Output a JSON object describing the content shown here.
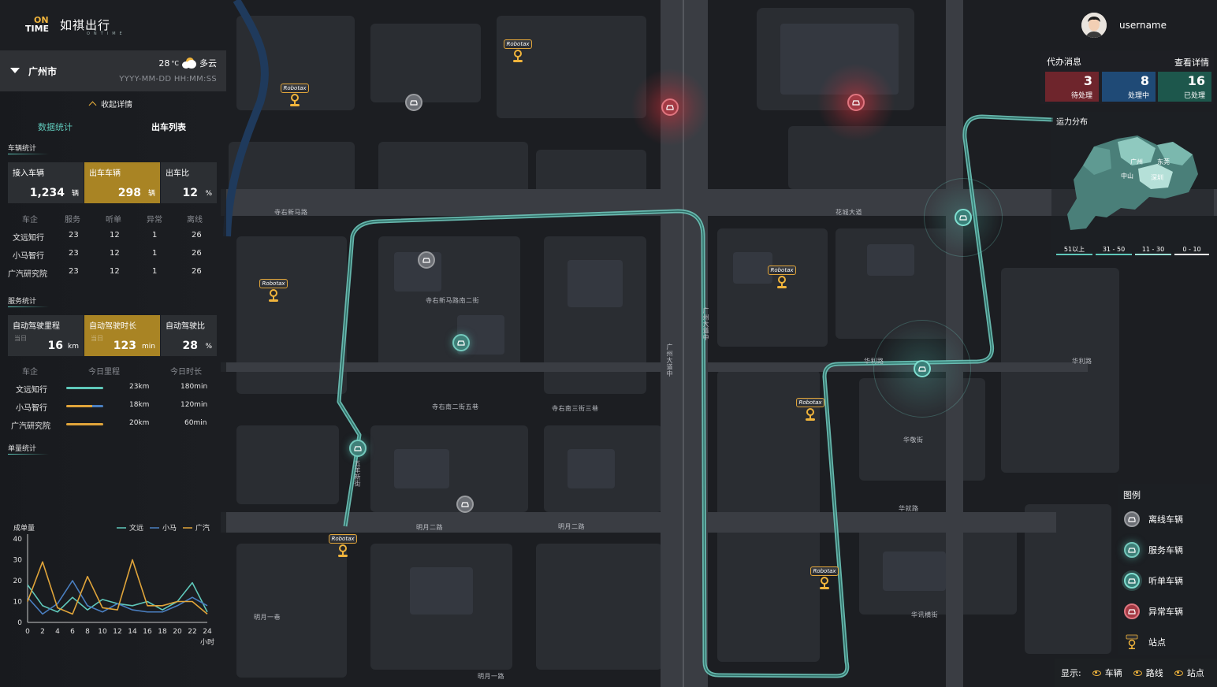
{
  "brand": {
    "mark_on": "ON",
    "mark_time": "TIME",
    "name_cn": "如祺出行",
    "name_en": "ONTIME"
  },
  "user": {
    "name": "username"
  },
  "city": {
    "name": "广州市",
    "temp": "28",
    "temp_unit": "°C",
    "weather": "多云",
    "datetime": "YYYY-MM-DD HH:MM:SS"
  },
  "panel": {
    "collapse_label": "收起详情",
    "tabs": {
      "stats": "数据统计",
      "list": "出车列表"
    },
    "vehicle_section": "车辆统计",
    "vehicle_kpis": [
      {
        "label": "接入车辆",
        "value": "1,234",
        "unit": "辆"
      },
      {
        "label": "出车车辆",
        "value": "298",
        "unit": "辆"
      },
      {
        "label": "出车比",
        "value": "12",
        "unit": "%"
      }
    ],
    "vehicle_table": {
      "headers": [
        "车企",
        "服务",
        "听单",
        "异常",
        "离线"
      ],
      "rows": [
        [
          "文远知行",
          "23",
          "12",
          "1",
          "26"
        ],
        [
          "小马智行",
          "23",
          "12",
          "1",
          "26"
        ],
        [
          "广汽研究院",
          "23",
          "12",
          "1",
          "26"
        ]
      ]
    },
    "service_section": "服务统计",
    "service_kpis": [
      {
        "label": "自动驾驶里程",
        "sub": "当日",
        "value": "16",
        "unit": "km"
      },
      {
        "label": "自动驾驶时长",
        "sub": "当日",
        "value": "123",
        "unit": "min"
      },
      {
        "label": "自动驾驶比",
        "sub": "",
        "value": "28",
        "unit": "%"
      }
    ],
    "service_table": {
      "headers": [
        "车企",
        "今日里程",
        "今日时长"
      ],
      "rows": [
        {
          "company": "文远知行",
          "mileage": "23km",
          "duration": "180min",
          "bar": 0.6
        },
        {
          "company": "小马智行",
          "mileage": "18km",
          "duration": "120min",
          "bar": 0.8
        },
        {
          "company": "广汽研究院",
          "mileage": "20km",
          "duration": "60min",
          "bar": 0.6
        }
      ]
    },
    "order_section": "单量统计"
  },
  "messages": {
    "title": "代办消息",
    "detail": "查看详情",
    "items": [
      {
        "count": "3",
        "label": "待处理",
        "color": "#7a2a30"
      },
      {
        "count": "8",
        "label": "处理中",
        "color": "#224d7a"
      },
      {
        "count": "16",
        "label": "已处理",
        "color": "#1f5a4f"
      }
    ]
  },
  "distribution": {
    "title": "运力分布",
    "cities": [
      "广州",
      "东莞",
      "中山",
      "深圳"
    ],
    "ranges": [
      {
        "label": "51以上",
        "color": "#5fc8ba"
      },
      {
        "label": "31 - 50",
        "color": "#5fc8ba"
      },
      {
        "label": "11 - 30",
        "color": "#9adfd5"
      },
      {
        "label": "0 - 10",
        "color": "#ffffff"
      }
    ]
  },
  "legend": {
    "title": "图例",
    "items": [
      "离线车辆",
      "服务车辆",
      "听单车辆",
      "异常车辆",
      "站点"
    ]
  },
  "display": {
    "label": "显示:",
    "options": [
      "车辆",
      "路线",
      "站点"
    ]
  },
  "station_label": "Robotax",
  "map_labels": [
    "寺右新马路",
    "寺右新马路南二街",
    "寺右南二街五巷",
    "寺右南三街三巷",
    "明月二路",
    "明月一巷",
    "明月一路",
    "华利路",
    "华就路",
    "华敬街",
    "华讯横街",
    "花城大道",
    "广州大道中",
    "五羊新街"
  ],
  "colors": {
    "accent": "#5fc8ba",
    "gold": "#f0b43c",
    "wenyuan": "#5fc8ba",
    "xiaoma": "#4a7fc1",
    "guangqi": "#e0a43a"
  },
  "chart_data": {
    "type": "line",
    "title": "",
    "ylabel": "成单量",
    "xlabel": "小时",
    "ylim": [
      0,
      40
    ],
    "yticks": [
      0,
      10,
      20,
      30,
      40
    ],
    "x": [
      0,
      2,
      4,
      6,
      8,
      10,
      12,
      14,
      16,
      18,
      20,
      22,
      24
    ],
    "series": [
      {
        "name": "文远",
        "color": "#5fc8ba",
        "values": [
          18,
          8,
          5,
          12,
          6,
          11,
          9,
          8,
          10,
          6,
          10,
          19,
          5
        ]
      },
      {
        "name": "小马",
        "color": "#4a7fc1",
        "values": [
          12,
          4,
          9,
          20,
          8,
          5,
          9,
          6,
          5,
          5,
          8,
          12,
          8
        ]
      },
      {
        "name": "广汽",
        "color": "#e0a43a",
        "values": [
          10,
          29,
          7,
          4,
          22,
          7,
          6,
          30,
          8,
          8,
          10,
          10,
          4
        ]
      }
    ]
  }
}
